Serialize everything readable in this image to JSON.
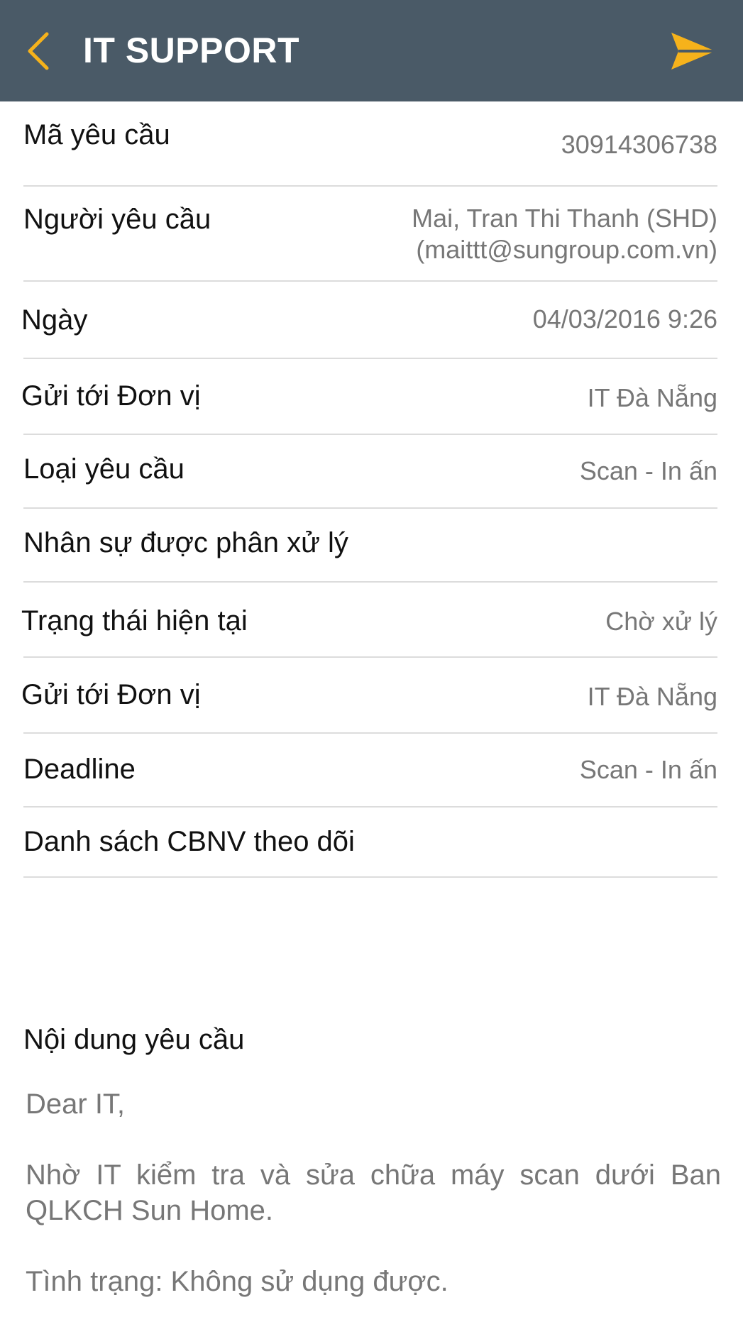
{
  "header": {
    "title": "IT SUPPORT",
    "back_icon": "chevron-left-icon",
    "send_icon": "send-icon",
    "accent_color": "#f6b21b",
    "bar_color": "#4a5a67"
  },
  "fields": [
    {
      "label": "Mã yêu cầu",
      "value": "30914306738"
    },
    {
      "label": "Người yêu cầu",
      "value_line1": "Mai, Tran Thi Thanh (SHD)",
      "value_line2": "(maittt@sungroup.com.vn)"
    },
    {
      "label": "Ngày",
      "value": "04/03/2016 9:26"
    },
    {
      "label": "Gửi tới Đơn vị",
      "value": "IT Đà Nẵng"
    },
    {
      "label": "Loại yêu cầu",
      "value": "Scan - In ấn"
    },
    {
      "label": "Nhân sự được phân xử lý",
      "value": ""
    },
    {
      "label": "Trạng thái hiện tại",
      "value": "Chờ xử lý"
    },
    {
      "label": "Gửi tới Đơn vị",
      "value": "IT Đà Nẵng"
    },
    {
      "label": "Deadline",
      "value": "Scan - In ấn"
    },
    {
      "label": "Danh sách CBNV theo dõi",
      "value": ""
    }
  ],
  "request_content": {
    "label": "Nội dung yêu cầu",
    "greeting": "Dear IT,",
    "paragraph": "Nhờ IT kiểm tra và sửa chữa máy scan dưới Ban QLKCH Sun Home.",
    "status_line": "Tình trạng: Không sử dụng được."
  }
}
